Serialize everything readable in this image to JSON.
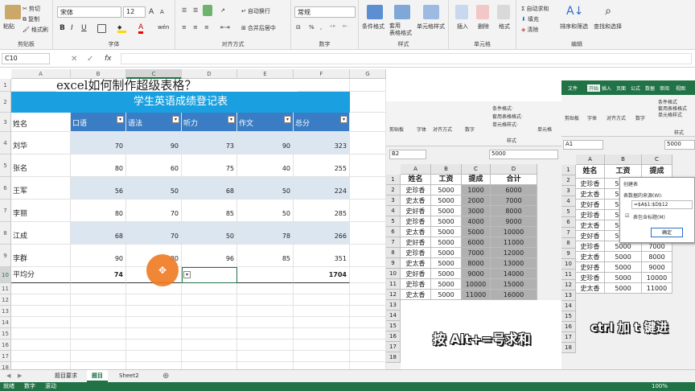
{
  "ribbon": {
    "clipboard": {
      "paste": "粘贴",
      "cut": "剪切",
      "copy": "复制",
      "format_painter": "格式刷",
      "label": "剪贴板"
    },
    "font": {
      "name": "宋体",
      "size": "12",
      "grow": "A",
      "shrink": "A",
      "bold": "B",
      "italic": "I",
      "underline": "U",
      "label": "字体",
      "wen": "wén"
    },
    "align": {
      "wrap": "自动换行",
      "merge": "合并后居中",
      "label": "对齐方式"
    },
    "number": {
      "format": "常规",
      "percent": "%",
      "comma": ",",
      "label": "数字"
    },
    "styles": {
      "cond": "条件格式",
      "table": "套用\n表格格式",
      "cell": "单元格样式",
      "label": "样式"
    },
    "cells": {
      "insert": "插入",
      "delete": "删除",
      "format": "格式",
      "label": "单元格"
    },
    "editing": {
      "autosum": "自动求和",
      "fill": "填充",
      "clear": "清除",
      "sort": "排序和筛选",
      "find": "查找和选择",
      "label": "编辑"
    }
  },
  "formula_bar": {
    "namebox": "C10",
    "fx": "fx",
    "value": ""
  },
  "columns": [
    "A",
    "B",
    "C",
    "D",
    "E",
    "F",
    "G",
    "H"
  ],
  "rows": [
    "1",
    "2",
    "3",
    "4",
    "5",
    "6",
    "7",
    "8",
    "9",
    "10",
    "11",
    "12",
    "13",
    "14",
    "15",
    "16",
    "17",
    "18",
    "19",
    "20",
    "21"
  ],
  "sheet": {
    "title": "excel如何制作超级表格？",
    "banner": "学生英语成绩登记表",
    "header_name": "姓名",
    "headers": [
      "口语",
      "语法",
      "听力",
      "作文",
      "总分"
    ],
    "students": [
      {
        "name": "刘华",
        "v": [
          "70",
          "90",
          "73",
          "90",
          "323"
        ]
      },
      {
        "name": "张名",
        "v": [
          "80",
          "60",
          "75",
          "40",
          "255"
        ]
      },
      {
        "name": "王军",
        "v": [
          "56",
          "50",
          "68",
          "50",
          "224"
        ]
      },
      {
        "name": "李丽",
        "v": [
          "80",
          "70",
          "85",
          "50",
          "285"
        ]
      },
      {
        "name": "江成",
        "v": [
          "68",
          "70",
          "50",
          "78",
          "266"
        ]
      },
      {
        "name": "李群",
        "v": [
          "90",
          "80",
          "96",
          "85",
          "351"
        ]
      }
    ],
    "avg_label": "平均分",
    "avg_b": "74",
    "avg_f": "1704"
  },
  "tabs": [
    "题目要求",
    "题目",
    "Sheet2"
  ],
  "active_tab": "题目",
  "status": [
    "就绪",
    "数字",
    "滚动"
  ],
  "zoom": "100%",
  "overlay1": {
    "namebox": "B2",
    "value": "5000",
    "ribbon": [
      "剪贴板",
      "字体",
      "对齐方式",
      "数字",
      "条件格式·",
      "套用表格格式·",
      "单元格样式·",
      "单元格",
      "样式"
    ],
    "cols": [
      "A",
      "B",
      "C",
      "D"
    ],
    "rowhdrs": [
      "1",
      "2",
      "3",
      "4",
      "5",
      "6",
      "7",
      "8",
      "9",
      "10",
      "11",
      "12",
      "13",
      "14",
      "15",
      "16",
      "17",
      "18"
    ],
    "header": [
      "姓名",
      "工资",
      "提成",
      "合计"
    ],
    "data": [
      [
        "史珍香",
        "5000",
        "1000",
        "6000"
      ],
      [
        "史太香",
        "5000",
        "2000",
        "7000"
      ],
      [
        "史好香",
        "5000",
        "3000",
        "8000"
      ],
      [
        "史珍香",
        "5000",
        "4000",
        "9000"
      ],
      [
        "史太香",
        "5000",
        "5000",
        "10000"
      ],
      [
        "史好香",
        "5000",
        "6000",
        "11000"
      ],
      [
        "史珍香",
        "5000",
        "7000",
        "12000"
      ],
      [
        "史太香",
        "5000",
        "8000",
        "13000"
      ],
      [
        "史好香",
        "5000",
        "9000",
        "14000"
      ],
      [
        "史珍香",
        "5000",
        "10000",
        "15000"
      ],
      [
        "史太香",
        "5000",
        "11000",
        "16000"
      ]
    ],
    "caption": "按 Alt+=号求和"
  },
  "overlay2": {
    "tabs": [
      "文件",
      "开始",
      "插入",
      "页面",
      "公式",
      "数据",
      "审阅",
      "视图"
    ],
    "namebox": "A1",
    "value": "5000",
    "ribbon": [
      "剪贴板",
      "字体",
      "对齐方式",
      "数字",
      "条件格式",
      "套用表格格式",
      "单元格样式",
      "样式"
    ],
    "cols": [
      "A",
      "B",
      "C"
    ],
    "rowhdrs": [
      "1",
      "2",
      "3",
      "4",
      "5",
      "6",
      "7",
      "8",
      "9",
      "10",
      "11",
      "12",
      "13",
      "14",
      "15",
      "16",
      "17",
      "18"
    ],
    "header": [
      "姓名",
      "工资",
      "提成"
    ],
    "data": [
      [
        "史珍香",
        "5000",
        "1000"
      ],
      [
        "史太香",
        "5000",
        "2000"
      ],
      [
        "史好香",
        "5000",
        "3000"
      ],
      [
        "史珍香",
        "5000",
        "4000"
      ],
      [
        "史太香",
        "5000",
        "5000"
      ],
      [
        "史好香",
        "5000",
        "6000"
      ],
      [
        "史珍香",
        "5000",
        "7000"
      ],
      [
        "史太香",
        "5000",
        "8000"
      ],
      [
        "史好香",
        "5000",
        "9000"
      ],
      [
        "史珍香",
        "5000",
        "10000"
      ],
      [
        "史太香",
        "5000",
        "11000"
      ]
    ],
    "dialog": {
      "title": "创建表",
      "prompt": "表数据的来源(W):",
      "range": "=$A$1:$D$12",
      "checkbox": "表包含标题(M)",
      "ok": "确定"
    },
    "caption": "ctrl 加 t 键进"
  },
  "colors": {
    "header_blue": "#3b7dc4",
    "band_blue": "#dce6f1",
    "banner_blue": "#1aa0e0",
    "cursor": "#f07a22",
    "excel_green": "#217346"
  }
}
